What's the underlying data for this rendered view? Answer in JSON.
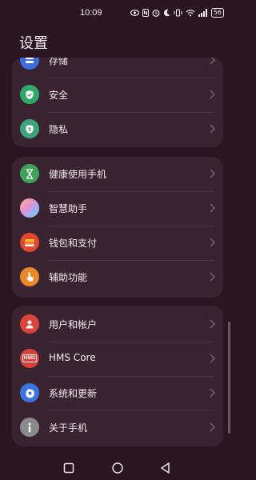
{
  "status": {
    "time": "10:09",
    "battery": "56",
    "icons": [
      "eye-icon",
      "nfc-icon",
      "alarm-icon",
      "moon-icon",
      "vibrate-icon",
      "wifi-icon",
      "signal-icon",
      "battery-icon"
    ]
  },
  "header": {
    "title": "设置"
  },
  "groups": [
    {
      "items": [
        {
          "label": "存储",
          "icon": "storage-icon",
          "color": "#3d6ee0"
        },
        {
          "label": "安全",
          "icon": "shield-icon",
          "color": "#2fa86a"
        },
        {
          "label": "隐私",
          "icon": "privacy-shield-icon",
          "color": "#3ea57a"
        }
      ]
    },
    {
      "items": [
        {
          "label": "健康使用手机",
          "icon": "hourglass-icon",
          "color": "#3fa25a"
        },
        {
          "label": "智慧助手",
          "icon": "assistant-orb-icon",
          "color": "#c9a0f0"
        },
        {
          "label": "钱包和支付",
          "icon": "wallet-icon",
          "color": "#e0472e"
        },
        {
          "label": "辅助功能",
          "icon": "hand-pointer-icon",
          "color": "#e8892a"
        }
      ]
    },
    {
      "items": [
        {
          "label": "用户和帐户",
          "icon": "user-icon",
          "color": "#d9453a"
        },
        {
          "label": "HMS Core",
          "icon": "hms-icon",
          "color": "#d9403a",
          "badge": "HMS"
        },
        {
          "label": "系统和更新",
          "icon": "gear-icon",
          "color": "#3a74e0"
        },
        {
          "label": "关于手机",
          "icon": "info-icon",
          "color": "#8a8a8a"
        }
      ]
    }
  ],
  "nav": {
    "buttons": [
      "recents-icon",
      "home-icon",
      "back-icon"
    ]
  }
}
